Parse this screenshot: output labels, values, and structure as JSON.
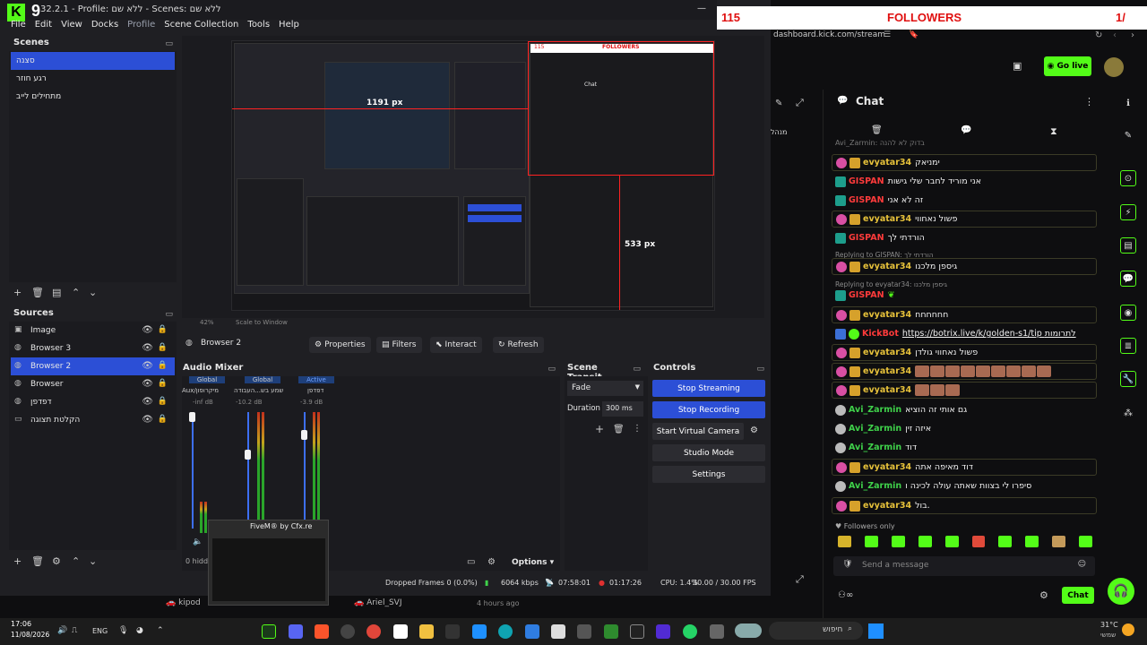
{
  "obs": {
    "kick_letter": "K",
    "kick_number": "9",
    "title": "32.2.1 - Profile: ללא שם - Scenes: ללא שם",
    "minimize": "—",
    "menu": [
      "File",
      "Edit",
      "View",
      "Docks",
      "Profile",
      "Scene Collection",
      "Tools",
      "Help"
    ]
  },
  "scenes": {
    "header": "Scenes",
    "items": [
      "סצנה",
      "רגע חוזר",
      "מתחילים לייב"
    ],
    "selected_index": 0
  },
  "sources": {
    "header": "Sources",
    "items": [
      {
        "name": "Image",
        "icon": "image-icon"
      },
      {
        "name": "Browser 3",
        "icon": "globe-icon"
      },
      {
        "name": "Browser 2",
        "icon": "globe-icon"
      },
      {
        "name": "Browser",
        "icon": "globe-icon"
      },
      {
        "name": "דפדפן",
        "icon": "globe-icon"
      },
      {
        "name": "הקלטת תצוגה",
        "icon": "monitor-icon"
      }
    ],
    "selected_index": 2
  },
  "preview": {
    "label_1191": "1191 px",
    "label_533": "533 px",
    "followers_label": "FOLLOWERS",
    "followers_count": "115",
    "inner_chat": "Chat",
    "zoom": "42%",
    "scale_label": "Scale to Window"
  },
  "context_bar": {
    "source": "Browser 2",
    "properties": "Properties",
    "filters": "Filters",
    "interact": "Interact",
    "refresh": "Refresh"
  },
  "audio_mixer": {
    "header": "Audio Mixer",
    "channels": [
      {
        "tag": "Global",
        "name": "Aux/מיקרופון",
        "db": "-inf dB"
      },
      {
        "tag": "Global",
        "name": "שמע בש...העבודה",
        "db": "-10.2 dB"
      },
      {
        "tag": "Active",
        "name": "דפדפן",
        "db": "-3.9 dB"
      }
    ],
    "hidden": "0 hidd"
  },
  "scene_transitions": {
    "header": "Scene Transit...",
    "transition": "Fade",
    "duration_label": "Duration",
    "duration_value": "300 ms"
  },
  "controls": {
    "header": "Controls",
    "stop_streaming": "Stop Streaming",
    "stop_recording": "Stop Recording",
    "virtual_camera": "Start Virtual Camera",
    "studio_mode": "Studio Mode",
    "settings": "Settings"
  },
  "status": {
    "options": "Options",
    "dropped": "Dropped Frames 0 (0.0%)",
    "bitrate": "6064 kbps",
    "stream_time": "07:58:01",
    "rec_time": "01:17:26",
    "cpu": "CPU: 1.4%",
    "fps": "30.00 / 30.00 FPS"
  },
  "tooltip": {
    "title": "FiveM® by Cfx.re"
  },
  "kick_panel": {
    "followers_count": "115",
    "followers_label": "FOLLOWERS",
    "followers_right": "1/",
    "url": "dashboard.kick.com/stream",
    "go_live": "Go live",
    "chat_title": "Chat",
    "left_cut": "מנהל",
    "followers_only": "Followers only",
    "send_placeholder": "Send a message",
    "chat_button": "Chat",
    "top_partial": "Avi_Zarmin: בדוק לא להנה",
    "messages": [
      {
        "user": "evyatar34",
        "text": "ימניאק",
        "color": "gold",
        "badges": [
          "b-pink",
          "b-gold"
        ],
        "box": true
      },
      {
        "user": "GISPAN",
        "text": "אני מוריד לחבר שלי גישות",
        "color": "red",
        "badges": [
          "b-teal"
        ],
        "box": false
      },
      {
        "user": "GISPAN",
        "text": "זה לא אני",
        "color": "red",
        "badges": [
          "b-teal"
        ],
        "box": false
      },
      {
        "user": "evyatar34",
        "text": "פשול נאחווי",
        "color": "gold",
        "badges": [
          "b-pink",
          "b-gold"
        ],
        "box": true
      },
      {
        "user": "GISPAN",
        "text": "הורדתי לך",
        "color": "red",
        "badges": [
          "b-teal"
        ],
        "box": false
      },
      {
        "user": "evyatar34",
        "text": "גיספן מלכנו",
        "color": "gold",
        "badges": [
          "b-pink",
          "b-gold"
        ],
        "box": true
      },
      {
        "user": "GISPAN",
        "text": "",
        "color": "red",
        "badges": [
          "b-teal"
        ],
        "box": false
      },
      {
        "user": "evyatar34",
        "text": "חחחחחח",
        "color": "gold",
        "badges": [
          "b-pink",
          "b-gold"
        ],
        "box": true
      },
      {
        "user": "KickBot",
        "text": "https://botrix.live/k/golden-s1/tip לתרומות",
        "color": "red",
        "badges": [
          "b-blue",
          "b-green"
        ],
        "box": false
      },
      {
        "user": "evyatar34",
        "text": "פשול נאחווי גולדן",
        "color": "gold",
        "badges": [
          "b-pink",
          "b-gold"
        ],
        "box": true
      },
      {
        "user": "evyatar34",
        "text": "",
        "color": "gold",
        "badges": [
          "b-pink",
          "b-gold"
        ],
        "box": true
      },
      {
        "user": "evyatar34",
        "text": "",
        "color": "gold",
        "badges": [
          "b-pink",
          "b-gold"
        ],
        "box": true
      },
      {
        "user": "Avi_Zarmin",
        "text": "גם אותי זה הוציא",
        "color": "green",
        "badges": [
          "b-grey"
        ],
        "box": false
      },
      {
        "user": "Avi_Zarmin",
        "text": "איזה זין",
        "color": "green",
        "badges": [
          "b-grey"
        ],
        "box": false
      },
      {
        "user": "Avi_Zarmin",
        "text": "דוד",
        "color": "green",
        "badges": [
          "b-grey"
        ],
        "box": false
      },
      {
        "user": "evyatar34",
        "text": "דוד מאיפה אתה",
        "color": "gold",
        "badges": [
          "b-pink",
          "b-gold"
        ],
        "box": true
      },
      {
        "user": "Avi_Zarmin",
        "text": "סיפרו לי בצוות שאתה עולה לכינה ו",
        "color": "green",
        "badges": [
          "b-grey"
        ],
        "box": false
      },
      {
        "user": "evyatar34",
        "text": "בול.",
        "color": "gold",
        "badges": [
          "b-pink",
          "b-gold"
        ],
        "box": true
      }
    ],
    "replies": [
      "Replying to GISPAN: הורדתי לך",
      "Replying to evyatar34: גיספן מלכנו"
    ]
  },
  "taskbar": {
    "time": "17:06",
    "date": "11/08/2026",
    "lang": "ENG",
    "search_text": "חיפוש",
    "weather_temp": "31°C",
    "weather_desc": "שמשי",
    "tab1": "kipod",
    "tab2": "Ariel_SVJ",
    "tab2_time": "4 hours ago"
  }
}
